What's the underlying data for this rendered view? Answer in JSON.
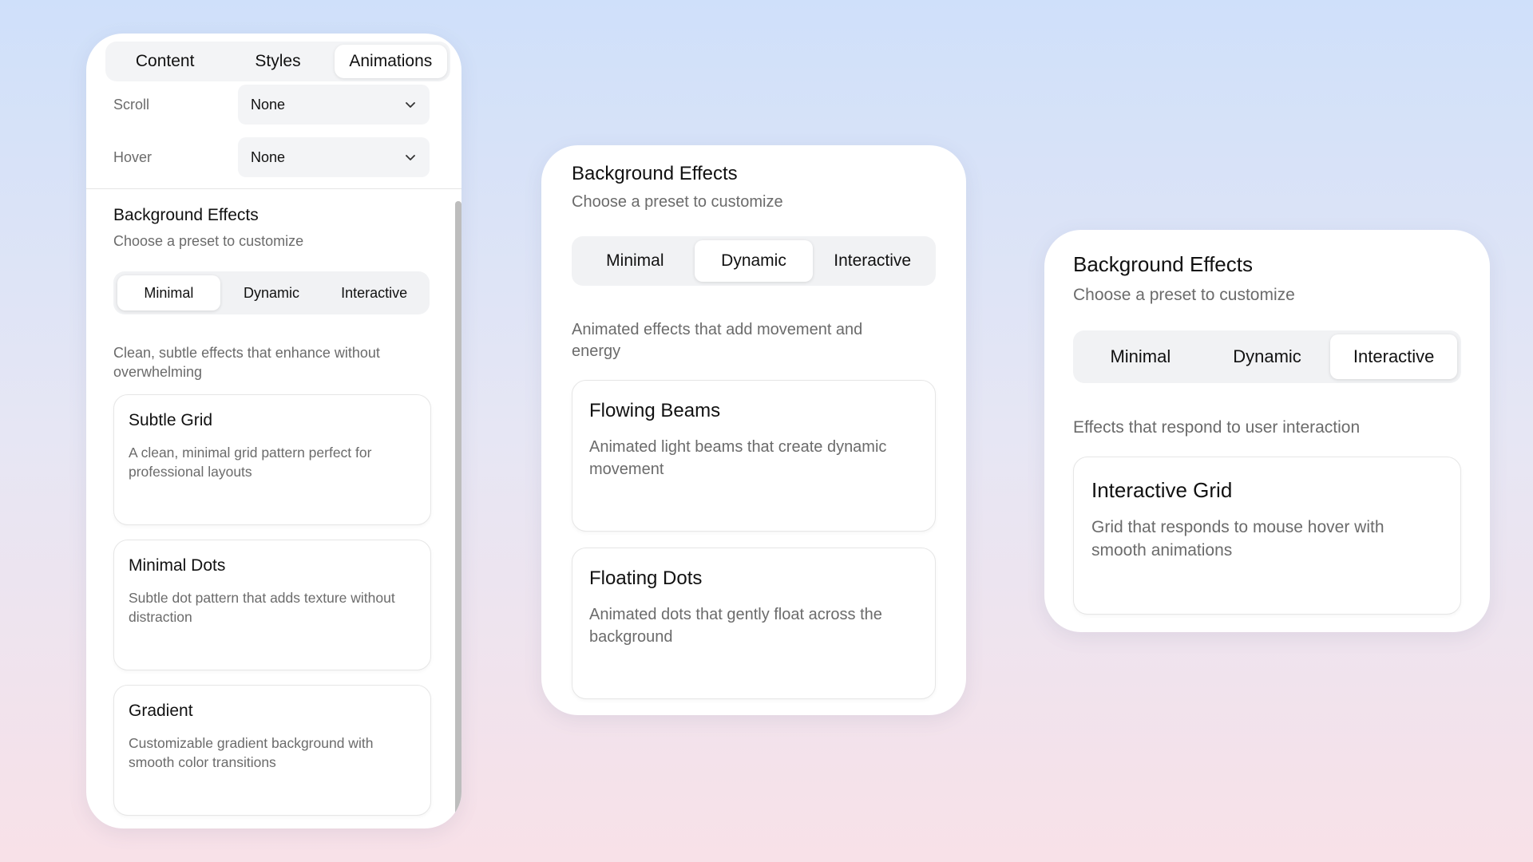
{
  "panel1": {
    "tabs": [
      {
        "label": "Content"
      },
      {
        "label": "Styles"
      },
      {
        "label": "Animations"
      }
    ],
    "scroll": {
      "label": "Scroll",
      "value": "None"
    },
    "hover": {
      "label": "Hover",
      "value": "None"
    },
    "title": "Background Effects",
    "subtitle": "Choose a preset to customize",
    "segments": [
      "Minimal",
      "Dynamic",
      "Interactive"
    ],
    "active_segment": "Minimal",
    "description": "Clean, subtle effects that enhance without overwhelming",
    "cards": [
      {
        "title": "Subtle Grid",
        "desc": "A clean, minimal grid pattern perfect for professional layouts"
      },
      {
        "title": "Minimal Dots",
        "desc": "Subtle dot pattern that adds texture without distraction"
      },
      {
        "title": "Gradient",
        "desc": "Customizable gradient background with smooth color transitions"
      }
    ]
  },
  "panel2": {
    "title": "Background Effects",
    "subtitle": "Choose a preset to customize",
    "segments": [
      "Minimal",
      "Dynamic",
      "Interactive"
    ],
    "active_segment": "Dynamic",
    "description": "Animated effects that add movement and energy",
    "cards": [
      {
        "title": "Flowing Beams",
        "desc": "Animated light beams that create dynamic movement"
      },
      {
        "title": "Floating Dots",
        "desc": "Animated dots that gently float across the background"
      }
    ]
  },
  "panel3": {
    "title": "Background Effects",
    "subtitle": "Choose a preset to customize",
    "segments": [
      "Minimal",
      "Dynamic",
      "Interactive"
    ],
    "active_segment": "Interactive",
    "description": "Effects that respond to user interaction",
    "cards": [
      {
        "title": "Interactive Grid",
        "desc": "Grid that responds to mouse hover with smooth animations"
      }
    ]
  },
  "colors": {
    "text_primary": "#111111",
    "text_secondary": "#6b6b6b",
    "panel_bg": "#ffffff",
    "segment_bg": "#f1f2f4"
  }
}
